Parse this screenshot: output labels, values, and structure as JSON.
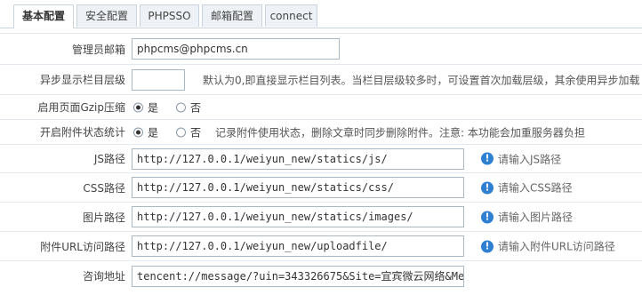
{
  "tabs": [
    {
      "label": "基本配置",
      "active": true
    },
    {
      "label": "安全配置",
      "active": false
    },
    {
      "label": "PHPSSO",
      "active": false
    },
    {
      "label": "邮箱配置",
      "active": false
    },
    {
      "label": "connect",
      "active": false
    }
  ],
  "form": {
    "admin_email": {
      "label": "管理员邮箱",
      "value": "phpcms@phpcms.cn"
    },
    "async_category": {
      "label": "异步显示栏目层级",
      "value": "",
      "hint": "默认为0,即直接显示栏目列表。当栏目层级较多时，可设置首次加载层级，其余使用异步加载"
    },
    "gzip": {
      "label": "启用页面Gzip压缩",
      "options": [
        "是",
        "否"
      ],
      "selected": "是"
    },
    "attachment_stat": {
      "label": "开启附件状态统计",
      "options": [
        "是",
        "否"
      ],
      "selected": "是",
      "hint": "记录附件使用状态，删除文章时同步删除附件。注意: 本功能会加重服务器负担"
    },
    "js_path": {
      "label": "JS路径",
      "value": "http://127.0.0.1/weiyun_new/statics/js/",
      "tip": "请输入JS路径"
    },
    "css_path": {
      "label": "CSS路径",
      "value": "http://127.0.0.1/weiyun_new/statics/css/",
      "tip": "请输入CSS路径"
    },
    "img_path": {
      "label": "图片路径",
      "value": "http://127.0.0.1/weiyun_new/statics/images/",
      "tip": "请输入图片路径"
    },
    "upload_url": {
      "label": "附件URL访问路径",
      "value": "http://127.0.0.1/weiyun_new/uploadfile/",
      "tip": "请输入附件URL访问路径"
    },
    "consult_url": {
      "label": "咨询地址",
      "value": "tencent://message/?uin=343326675&Site=宜宾微云网络&Me"
    }
  },
  "icons": {
    "info": "info-circle-icon",
    "info_color": "#2f80d1"
  },
  "colors": {
    "tab_bg": "#eef2f6",
    "border": "#c9d4de",
    "row_border": "#e3e9ef"
  }
}
